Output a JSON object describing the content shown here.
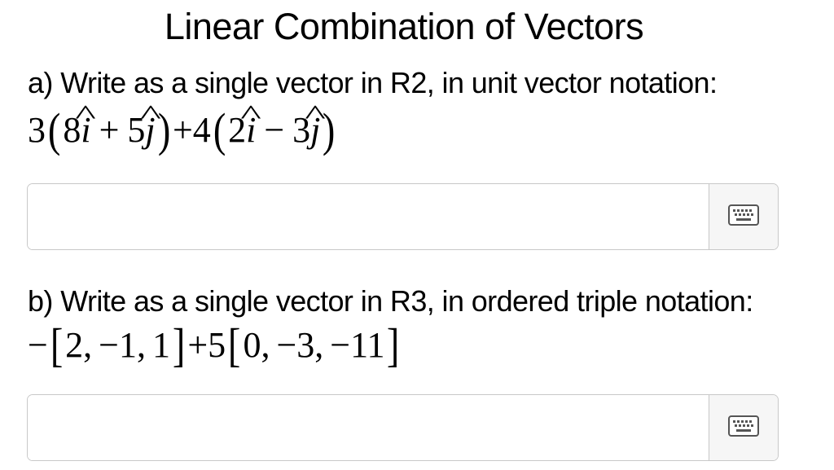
{
  "page": {
    "title": "Linear Combination of Vectors"
  },
  "part_a": {
    "prompt": "a) Write as a single vector in R2, in unit vector notation:",
    "expression": {
      "coef1": "3",
      "v1_x": "8",
      "v1_op": "+",
      "v1_y": "5",
      "coef2": "+4",
      "v2_x": "2",
      "v2_op": "−",
      "v2_y": "3",
      "i_symbol": "i",
      "j_symbol": "j",
      "hat": "^"
    },
    "answer": {
      "value": "",
      "placeholder": ""
    },
    "keyboard_icon": "keyboard-icon"
  },
  "part_b": {
    "prompt": "b) Write as a single vector in R3, in ordered triple notation:",
    "expression": {
      "coef1": "−",
      "v1": [
        "2,",
        "−1,",
        "1"
      ],
      "coef2": "+5",
      "v2": [
        "0,",
        "−3,",
        "−11"
      ]
    },
    "answer": {
      "value": "",
      "placeholder": ""
    },
    "keyboard_icon": "keyboard-icon"
  },
  "colors": {
    "border": "#c8c8c8",
    "button_bg": "#f6f6f6",
    "icon": "#555555"
  }
}
